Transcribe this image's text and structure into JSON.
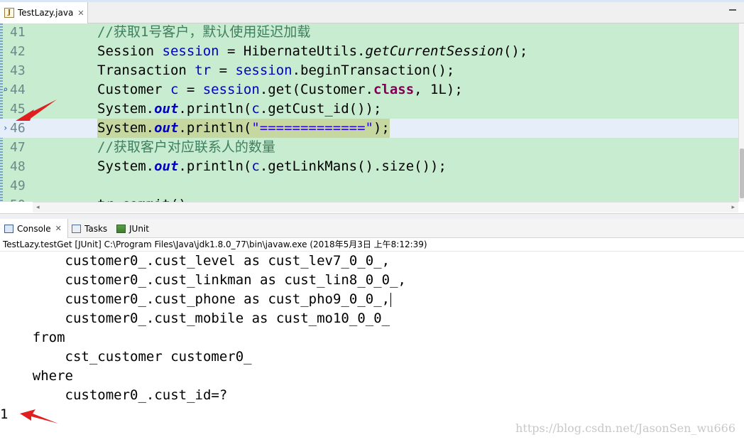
{
  "editor": {
    "tab_label": "TestLazy.java",
    "lines": [
      {
        "num": "41",
        "comment": "//获取1号客户，默认使用延迟加载"
      },
      {
        "num": "42"
      },
      {
        "num": "43"
      },
      {
        "num": "44"
      },
      {
        "num": "45"
      },
      {
        "num": "46"
      },
      {
        "num": "47",
        "comment": "//获取客户对应联系人的数量"
      },
      {
        "num": "48"
      },
      {
        "num": "49"
      },
      {
        "num": "50",
        "partial": "tr.commit();"
      }
    ]
  },
  "console": {
    "tabs": [
      {
        "label": "Console"
      },
      {
        "label": "Tasks"
      },
      {
        "label": "JUnit"
      }
    ],
    "status": "TestLazy.testGet [JUnit] C:\\Program Files\\Java\\jdk1.8.0_77\\bin\\javaw.exe (2018年5月3日 上午8:12:39)",
    "output": [
      "        customer0_.cust_level as cust_lev7_0_0_,",
      "        customer0_.cust_linkman as cust_lin8_0_0_,",
      "        customer0_.cust_phone as cust_pho9_0_0_,",
      "        customer0_.cust_mobile as cust_mo10_0_0_",
      "    from",
      "        cst_customer customer0_",
      "    where",
      "        customer0_.cust_id=?",
      "1"
    ],
    "watermark": "https://blog.csdn.net/JasonSen_wu666"
  },
  "colors": {
    "code_bg": "#c8ecd0",
    "current_line": "#e6eef9",
    "highlight": "#c6d8a0",
    "arrow": "#e02020"
  },
  "icons": [
    "java-file-icon",
    "close-icon",
    "minimize-icon",
    "console-icon",
    "tasks-icon",
    "junit-icon",
    "bookmark-icon",
    "debug-arrow-icon"
  ]
}
